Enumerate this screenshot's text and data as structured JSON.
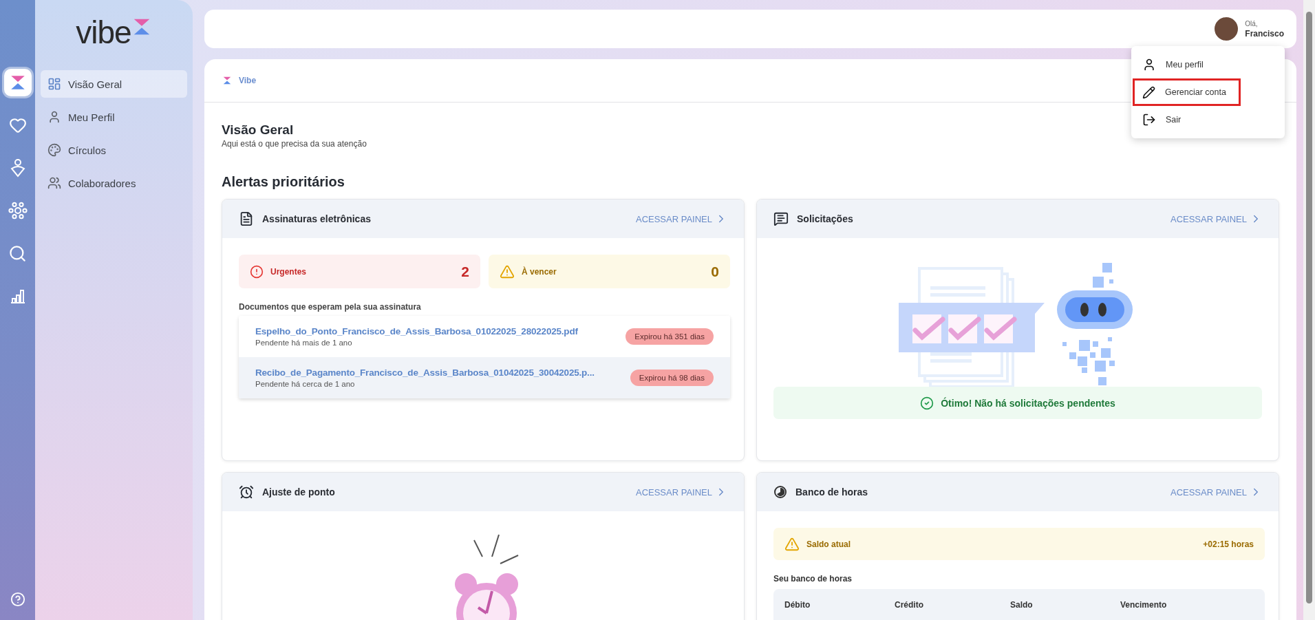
{
  "rail": {
    "items": [
      {
        "kind": "logo",
        "selected": true
      },
      {
        "kind": "heart",
        "selected": false
      },
      {
        "kind": "person",
        "selected": false
      },
      {
        "kind": "hub",
        "selected": false
      },
      {
        "kind": "search",
        "selected": false
      },
      {
        "kind": "chart",
        "selected": false
      }
    ]
  },
  "sidebar": {
    "brand": "vibe",
    "items": [
      {
        "label": "Visão Geral",
        "kind": "dashboard",
        "selected": true
      },
      {
        "label": "Meu Perfil",
        "kind": "user",
        "selected": false
      },
      {
        "label": "Círculos",
        "kind": "circles",
        "selected": false
      },
      {
        "label": "Colaboradores",
        "kind": "team",
        "selected": false
      }
    ]
  },
  "header": {
    "greeting": "Olá,",
    "user": "Francisco"
  },
  "user_menu": {
    "items": [
      {
        "label": "Meu perfil",
        "kind": "profile",
        "highlighted": false
      },
      {
        "label": "Gerenciar conta",
        "kind": "edit",
        "highlighted": true
      },
      {
        "label": "Sair",
        "kind": "logout",
        "highlighted": false
      }
    ]
  },
  "breadcrumb": "Vibe",
  "page": {
    "title": "Visão Geral",
    "subtitle": "Aqui está o que precisa da sua atenção"
  },
  "section_title": "Alertas prioritários",
  "signatures_card": {
    "title": "Assinaturas eletrônicas",
    "link": "ACESSAR PAINEL",
    "counters": [
      {
        "kind": "urgent",
        "label": "Urgentes",
        "count": "2"
      },
      {
        "kind": "due",
        "label": "À vencer",
        "count": "0"
      }
    ],
    "documents_label": "Documentos que esperam pela sua assinatura",
    "documents": [
      {
        "name": "Espelho_do_Ponto_Francisco_de_Assis_Barbosa_01022025_28022025.pdf",
        "status": "Pendente há mais de 1 ano",
        "badge": "Expirou há 351 dias",
        "hovered": false
      },
      {
        "name": "Recibo_de_Pagamento_Francisco_de_Assis_Barbosa_01042025_30042025.p...",
        "status": "Pendente há cerca de 1 ano",
        "badge": "Expirou há 98 dias",
        "hovered": true
      }
    ]
  },
  "requests_card": {
    "title": "Solicitações",
    "link": "ACESSAR PAINEL",
    "empty_message": "Ótimo! Não há solicitações pendentes"
  },
  "time_adjust_card": {
    "title": "Ajuste de ponto",
    "link": "ACESSAR PAINEL"
  },
  "hours_bank_card": {
    "title": "Banco de horas",
    "link": "ACESSAR PAINEL",
    "balance": {
      "label": "Saldo atual",
      "value": "+02:15 horas"
    },
    "table_label": "Seu banco de horas",
    "columns": [
      "Débito",
      "Crédito",
      "Saldo",
      "Vencimento"
    ]
  }
}
